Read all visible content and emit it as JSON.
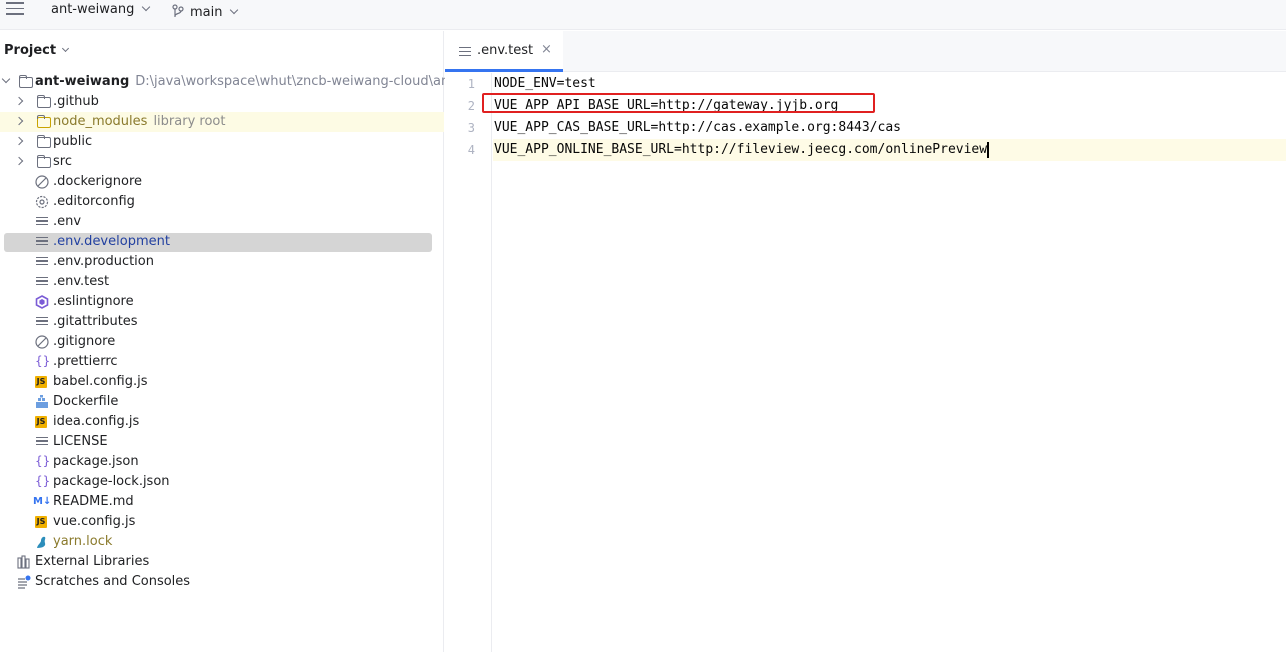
{
  "topbar": {
    "project_name": "ant-weiwang",
    "branch_name": "main"
  },
  "project_panel": {
    "title": "Project",
    "root": {
      "label": "ant-weiwang",
      "path": "D:\\java\\workspace\\whut\\zncb-weiwang-cloud\\ant-"
    },
    "items": [
      {
        "label": ".github",
        "icon": "folder-icon",
        "expandable": true
      },
      {
        "label": "node_modules",
        "note": "library root",
        "icon": "folder-icon",
        "expandable": true
      },
      {
        "label": "public",
        "icon": "folder-icon",
        "expandable": true
      },
      {
        "label": "src",
        "icon": "folder-icon",
        "expandable": true
      },
      {
        "label": ".dockerignore",
        "icon": "ignore-file-icon"
      },
      {
        "label": ".editorconfig",
        "icon": "settings-file-icon"
      },
      {
        "label": ".env",
        "icon": "text-file-icon"
      },
      {
        "label": ".env.development",
        "icon": "text-file-icon",
        "selected": true
      },
      {
        "label": ".env.production",
        "icon": "text-file-icon"
      },
      {
        "label": ".env.test",
        "icon": "text-file-icon"
      },
      {
        "label": ".eslintignore",
        "icon": "eslint-icon"
      },
      {
        "label": ".gitattributes",
        "icon": "text-file-icon"
      },
      {
        "label": ".gitignore",
        "icon": "ignore-file-icon"
      },
      {
        "label": ".prettierrc",
        "icon": "json-file-icon"
      },
      {
        "label": "babel.config.js",
        "icon": "js-file-icon"
      },
      {
        "label": "Dockerfile",
        "icon": "docker-file-icon"
      },
      {
        "label": "idea.config.js",
        "icon": "js-file-icon"
      },
      {
        "label": "LICENSE",
        "icon": "text-file-icon"
      },
      {
        "label": "package.json",
        "icon": "json-file-icon"
      },
      {
        "label": "package-lock.json",
        "icon": "json-file-icon"
      },
      {
        "label": "README.md",
        "icon": "markdown-file-icon"
      },
      {
        "label": "vue.config.js",
        "icon": "js-file-icon"
      },
      {
        "label": "yarn.lock",
        "icon": "yarn-file-icon"
      }
    ],
    "external_libraries": "External Libraries",
    "scratches": "Scratches and Consoles"
  },
  "editor": {
    "tab_label": ".env.test",
    "tab_close": "×",
    "lines": [
      {
        "num": "1",
        "text": "NODE_ENV=test"
      },
      {
        "num": "2",
        "text": "VUE_APP_API_BASE_URL=http://gateway.jyjb.org"
      },
      {
        "num": "3",
        "text": "VUE_APP_CAS_BASE_URL=http://cas.example.org:8443/cas"
      },
      {
        "num": "4",
        "text": "VUE_APP_ONLINE_BASE_URL=http://fileview.jeecg.com/onlinePreview"
      }
    ]
  },
  "colors": {
    "accent": "#3574f0",
    "highlight_box": "#e02020",
    "selection": "#d5d5d5",
    "library_row": "#fdfbe4",
    "yarn_text": "#8a7a2c"
  }
}
